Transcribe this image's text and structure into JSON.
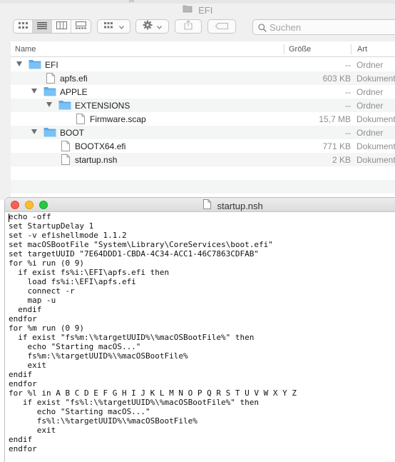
{
  "finder": {
    "title": "EFI",
    "search_placeholder": "Suchen",
    "columns": {
      "name": "Name",
      "size": "Größe",
      "kind": "Art"
    },
    "rows": [
      {
        "name": "EFI",
        "size": "--",
        "kind": "Ordner",
        "type": "folder",
        "expanded": true,
        "level": 0
      },
      {
        "name": "apfs.efi",
        "size": "603 KB",
        "kind": "Dokument",
        "type": "file",
        "level": 1
      },
      {
        "name": "APPLE",
        "size": "--",
        "kind": "Ordner",
        "type": "folder",
        "expanded": true,
        "level": 1
      },
      {
        "name": "EXTENSIONS",
        "size": "--",
        "kind": "Ordner",
        "type": "folder",
        "expanded": true,
        "level": 2
      },
      {
        "name": "Firmware.scap",
        "size": "15,7 MB",
        "kind": "Dokument",
        "type": "file",
        "level": 3
      },
      {
        "name": "BOOT",
        "size": "--",
        "kind": "Ordner",
        "type": "folder",
        "expanded": true,
        "level": 1
      },
      {
        "name": "BOOTX64.efi",
        "size": "771 KB",
        "kind": "Dokument",
        "type": "file",
        "level": 2
      },
      {
        "name": "startup.nsh",
        "size": "2 KB",
        "kind": "Dokument",
        "type": "file",
        "level": 2
      }
    ]
  },
  "editor": {
    "title": "startup.nsh",
    "lines": [
      "echo -off",
      "set StartupDelay 1",
      "set -v efishellmode 1.1.2",
      "set macOSBootFile \"System\\Library\\CoreServices\\boot.efi\"",
      "set targetUUID \"7E64DDD1-CBDA-4C34-ACC1-46C7863CDFAB\"",
      "for %i run (0 9)",
      "  if exist fs%i:\\EFI\\apfs.efi then",
      "    load fs%i:\\EFI\\apfs.efi",
      "    connect -r",
      "    map -u",
      "  endif",
      "endfor",
      "for %m run (0 9)",
      "  if exist \"fs%m:\\%targetUUID%\\%macOSBootFile%\" then",
      "    echo \"Starting macOS...\"",
      "    fs%m:\\%targetUUID%\\%macOSBootFile%",
      "    exit",
      "endif",
      "endfor",
      "for %l in A B C D E F G H I J K L M N O P Q R S T U V W X Y Z",
      "   if exist \"fs%l:\\%targetUUID%\\%macOSBootFile%\" then",
      "      echo \"Starting macOS...\"",
      "      fs%l:\\%targetUUID%\\%macOSBootFile%",
      "      exit",
      "endif",
      "endfor"
    ]
  },
  "colors": {
    "folder": "#6ab7ef",
    "close": "#fc5f57",
    "minimize": "#fdbc2e",
    "zoom": "#27c840"
  },
  "icons": {
    "window_folder": "folder-icon",
    "view_modes": [
      "icon-view-icon",
      "list-view-icon",
      "column-view-icon",
      "gallery-view-icon"
    ],
    "group": "group-icon",
    "action": "gear-icon",
    "share": "share-icon",
    "tags": "tag-icon",
    "search": "search-icon",
    "document": "document-icon"
  }
}
